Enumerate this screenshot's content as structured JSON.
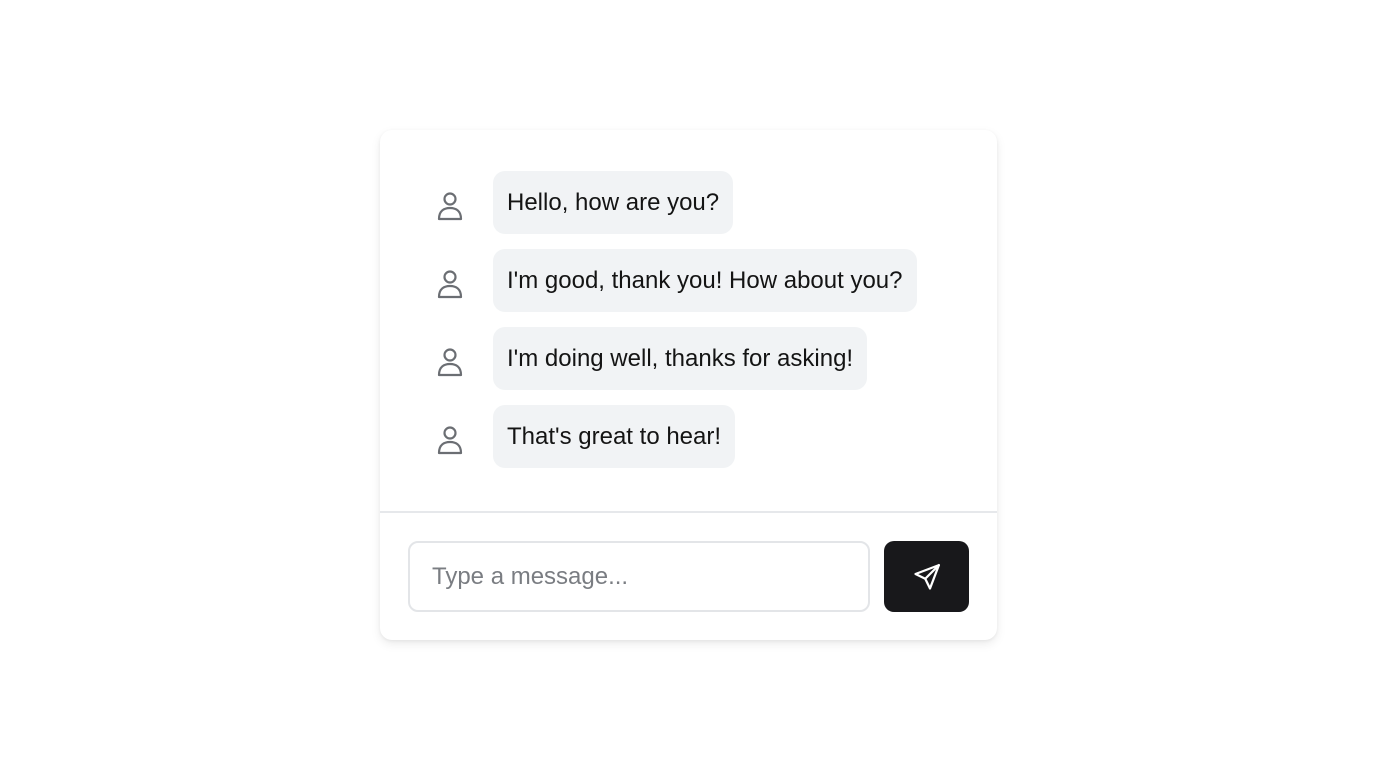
{
  "chat": {
    "messages": [
      {
        "text": "Hello, how are you?",
        "avatar_icon": "user-icon"
      },
      {
        "text": "I'm good, thank you! How about you?",
        "avatar_icon": "user-icon"
      },
      {
        "text": "I'm doing well, thanks for asking!",
        "avatar_icon": "user-icon"
      },
      {
        "text": "That's great to hear!",
        "avatar_icon": "user-icon"
      }
    ]
  },
  "composer": {
    "placeholder": "Type a message...",
    "value": "",
    "send_icon": "send-icon"
  },
  "colors": {
    "bubble_bg": "#f1f3f5",
    "send_button_bg": "#18181b",
    "icon_gray": "#6b6e73"
  }
}
